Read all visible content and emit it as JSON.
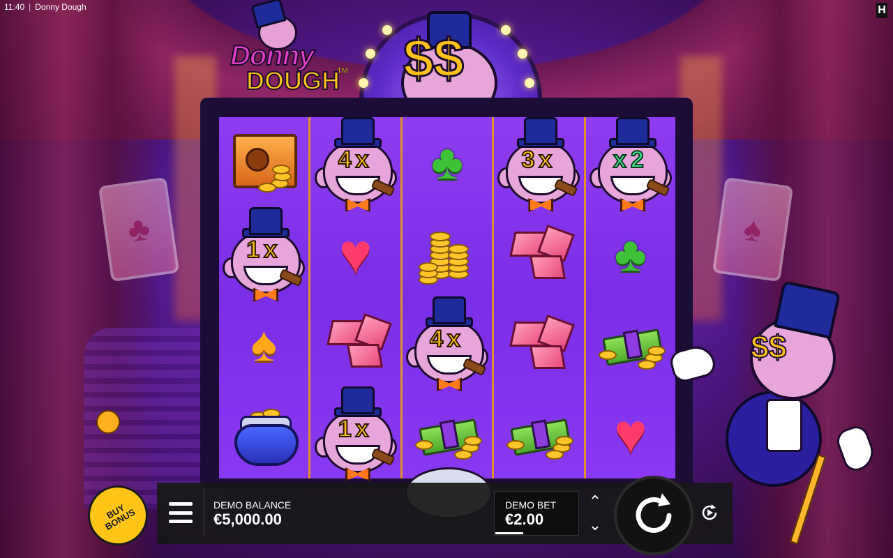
{
  "status_bar": {
    "time": "11:40",
    "separator": "|",
    "app_title": "Donny Dough"
  },
  "provider_badge": {
    "letter": "H"
  },
  "logo": {
    "line1": "Donny",
    "line2": "DOUGH",
    "tm": "TM"
  },
  "marquee": {
    "symbol": "$$"
  },
  "mascot": {
    "symbol": "$$"
  },
  "reels": [
    [
      {
        "symbol": "safe"
      },
      {
        "symbol": "donny",
        "multiplier": "1x"
      },
      {
        "symbol": "spade",
        "glyph": "♠"
      },
      {
        "symbol": "purse"
      }
    ],
    [
      {
        "symbol": "donny",
        "multiplier": "4x"
      },
      {
        "symbol": "heart",
        "glyph": "♥"
      },
      {
        "symbol": "gems"
      },
      {
        "symbol": "donny",
        "multiplier": "1x"
      }
    ],
    [
      {
        "symbol": "club",
        "glyph": "♣"
      },
      {
        "symbol": "coin-stack"
      },
      {
        "symbol": "donny",
        "multiplier": "4x"
      },
      {
        "symbol": "cash"
      }
    ],
    [
      {
        "symbol": "donny",
        "multiplier": "3x"
      },
      {
        "symbol": "gems"
      },
      {
        "symbol": "gems"
      },
      {
        "symbol": "cash"
      }
    ],
    [
      {
        "symbol": "donny",
        "multiplier": "x2",
        "color": "green"
      },
      {
        "symbol": "club",
        "glyph": "♣"
      },
      {
        "symbol": "cash"
      },
      {
        "symbol": "heart",
        "glyph": "♥"
      }
    ]
  ],
  "controls": {
    "buy_bonus_line1": "BUY",
    "buy_bonus_line2": "BONUS",
    "balance_label": "DEMO BALANCE",
    "balance_value": "€5,000.00",
    "bet_label": "DEMO BET",
    "bet_value": "€2.00",
    "bet_up": "⌃",
    "bet_down": "⌄"
  },
  "colors": {
    "reel_bg": "#7a2ee6",
    "reel_divider": "#e0912a",
    "accent_gold": "#ffc21a",
    "panel_bg": "#181818"
  },
  "icons": {
    "menu": "hamburger-icon",
    "spin": "spin-arrow-icon",
    "autoplay": "autoplay-icon"
  }
}
